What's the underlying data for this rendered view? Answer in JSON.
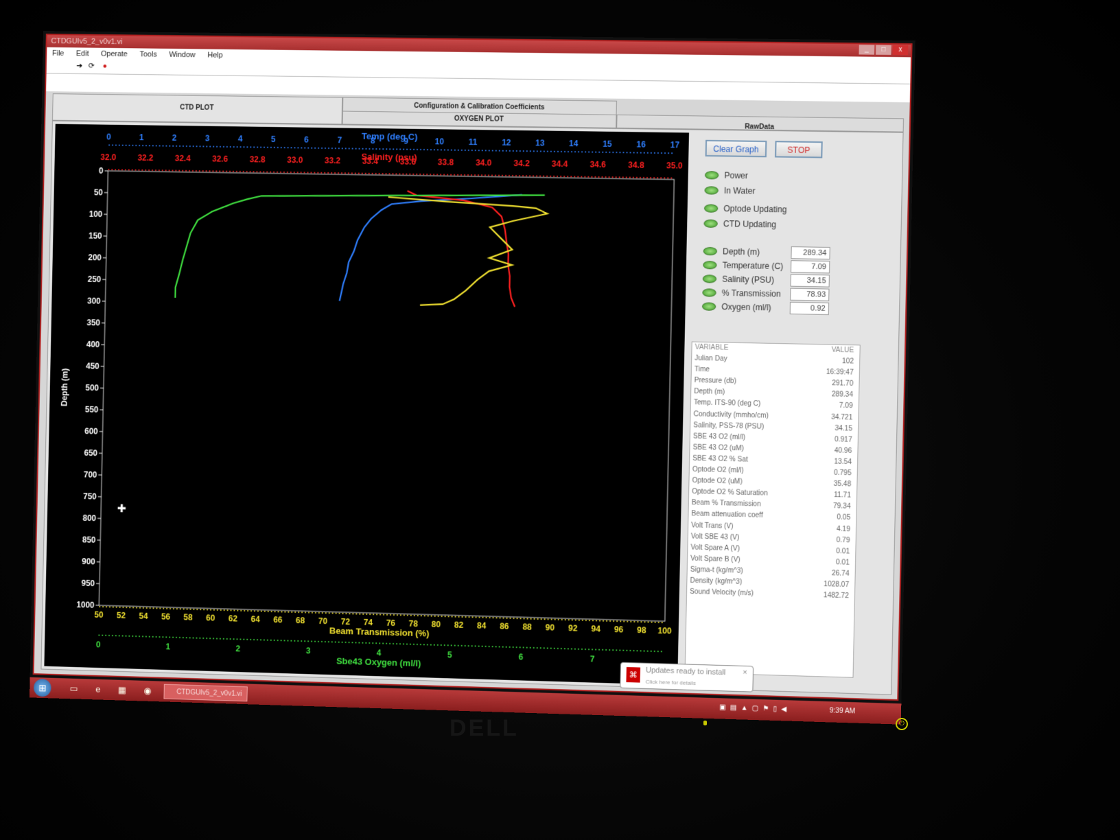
{
  "window": {
    "title": "CTDGUIv5_2_v0v1.vi",
    "controls": [
      "_",
      "□",
      "x"
    ]
  },
  "menu": [
    "File",
    "Edit",
    "Operate",
    "Tools",
    "Window",
    "Help"
  ],
  "toolbar_icons": [
    "run-arrow-icon",
    "run-continuous-icon",
    "abort-icon"
  ],
  "tabs": {
    "ctd": "CTD PLOT",
    "config": "Configuration & Calibration Coefficients",
    "oxygen": "OXYGEN PLOT",
    "raw": "RawData"
  },
  "buttons": {
    "clear": "Clear Graph",
    "stop": "STOP"
  },
  "indicators": [
    "Power",
    "In Water",
    "Optode Updating",
    "CTD Updating"
  ],
  "readouts": [
    {
      "label": "Depth (m)",
      "value": "289.34"
    },
    {
      "label": "Temperature (C)",
      "value": "7.09"
    },
    {
      "label": "Salinity (PSU)",
      "value": "34.15"
    },
    {
      "label": "% Transmission",
      "value": "78.93"
    },
    {
      "label": "Oxygen (ml/l)",
      "value": "0.92"
    }
  ],
  "variables": {
    "header": [
      "VARIABLE",
      "VALUE"
    ],
    "rows": [
      [
        "Julian Day",
        "102"
      ],
      [
        "Time",
        "16:39:47"
      ],
      [
        "Pressure (db)",
        "291.70"
      ],
      [
        "Depth (m)",
        "289.34"
      ],
      [
        "Temp. ITS-90 (deg C)",
        "7.09"
      ],
      [
        "Conductivity (mmho/cm)",
        "34.721"
      ],
      [
        "Salinity, PSS-78 (PSU)",
        "34.15"
      ],
      [
        "SBE 43 O2 (ml/l)",
        "0.917"
      ],
      [
        "SBE 43 O2 (uM)",
        "40.96"
      ],
      [
        "SBE 43 O2 % Sat",
        "13.54"
      ],
      [
        "Optode O2 (ml/l)",
        "0.795"
      ],
      [
        "Optode O2 (uM)",
        "35.48"
      ],
      [
        "Optode O2 % Saturation",
        "11.71"
      ],
      [
        "Beam % Transmission",
        "79.34"
      ],
      [
        "Beam attenuation coeff",
        "0.05"
      ],
      [
        "Volt Trans (V)",
        "4.19"
      ],
      [
        "Volt SBE 43 (V)",
        "0.79"
      ],
      [
        "Volt Spare A (V)",
        "0.01"
      ],
      [
        "Volt Spare B (V)",
        "0.01"
      ],
      [
        "Sigma-t (kg/m^3)",
        "26.74"
      ],
      [
        "Density (kg/m^3)",
        "1028.07"
      ],
      [
        "Sound Velocity (m/s)",
        "1482.72"
      ]
    ]
  },
  "chart_data": {
    "type": "line",
    "ylabel": "Depth (m)",
    "ylim": [
      1000,
      0
    ],
    "yticks": [
      0,
      50,
      100,
      150,
      200,
      250,
      300,
      350,
      400,
      450,
      500,
      550,
      600,
      650,
      700,
      750,
      800,
      850,
      900,
      950,
      1000
    ],
    "axes": {
      "temp": {
        "label": "Temp (deg C)",
        "range": [
          0,
          17
        ],
        "ticks": [
          0,
          1,
          2,
          3,
          4,
          5,
          6,
          7,
          8,
          9,
          10,
          11,
          12,
          13,
          14,
          15,
          16,
          17
        ],
        "color": "#2f7fff"
      },
      "salinity": {
        "label": "Salinity (psu)",
        "range": [
          32.0,
          35.0
        ],
        "ticks": [
          "32.0",
          "32.2",
          "32.4",
          "32.6",
          "32.8",
          "33.0",
          "33.2",
          "33.4",
          "33.6",
          "33.8",
          "34.0",
          "34.2",
          "34.4",
          "34.6",
          "34.8",
          "35.0"
        ],
        "color": "#ff2020"
      },
      "transmission": {
        "label": "Beam Transmission (%)",
        "range": [
          50,
          100
        ],
        "ticks": [
          50,
          52,
          54,
          56,
          58,
          60,
          62,
          64,
          66,
          68,
          70,
          72,
          74,
          76,
          78,
          80,
          82,
          84,
          86,
          88,
          90,
          92,
          94,
          96,
          98,
          100
        ],
        "color": "#f0e030"
      },
      "oxygen": {
        "label": "Sbe43 Oxygen (ml/l)",
        "range": [
          0,
          8
        ],
        "ticks": [
          0,
          1,
          2,
          3,
          4,
          5,
          6,
          7
        ],
        "color": "#40e040"
      }
    },
    "series": [
      {
        "axis": "temp",
        "color": "#2f7fff",
        "points": [
          [
            12.5,
            40
          ],
          [
            11,
            50
          ],
          [
            9.5,
            58
          ],
          [
            8.6,
            66
          ],
          [
            8.3,
            80
          ],
          [
            8.0,
            100
          ],
          [
            7.8,
            120
          ],
          [
            7.6,
            150
          ],
          [
            7.5,
            175
          ],
          [
            7.35,
            200
          ],
          [
            7.3,
            225
          ],
          [
            7.2,
            250
          ],
          [
            7.15,
            270
          ],
          [
            7.1,
            289
          ]
        ]
      },
      {
        "axis": "salinity",
        "points": [
          [
            33.6,
            35
          ],
          [
            33.65,
            45
          ],
          [
            33.9,
            55
          ],
          [
            34.05,
            70
          ],
          [
            34.1,
            90
          ],
          [
            34.12,
            120
          ],
          [
            34.13,
            150
          ],
          [
            34.14,
            175
          ],
          [
            34.14,
            200
          ],
          [
            34.15,
            225
          ],
          [
            34.15,
            250
          ],
          [
            34.16,
            275
          ],
          [
            34.18,
            295
          ]
        ],
        "color": "#ff2020"
      },
      {
        "axis": "transmission",
        "points": [
          [
            75,
            50
          ],
          [
            80,
            58
          ],
          [
            86,
            66
          ],
          [
            88,
            70
          ],
          [
            89,
            82
          ],
          [
            86,
            100
          ],
          [
            84,
            115
          ],
          [
            85,
            140
          ],
          [
            86,
            165
          ],
          [
            84,
            185
          ],
          [
            86,
            200
          ],
          [
            84,
            215
          ],
          [
            83,
            235
          ],
          [
            82,
            260
          ],
          [
            81,
            280
          ],
          [
            80,
            292
          ],
          [
            78,
            295
          ]
        ],
        "color": "#f0e030"
      },
      {
        "axis": "oxygen",
        "points": [
          [
            6.2,
            40
          ],
          [
            4.5,
            45
          ],
          [
            2.2,
            52
          ],
          [
            2.0,
            60
          ],
          [
            1.8,
            70
          ],
          [
            1.5,
            90
          ],
          [
            1.3,
            110
          ],
          [
            1.2,
            140
          ],
          [
            1.15,
            170
          ],
          [
            1.1,
            200
          ],
          [
            1.05,
            235
          ],
          [
            1.0,
            265
          ],
          [
            1.0,
            289
          ]
        ],
        "color": "#40e040"
      }
    ]
  },
  "taskbar": {
    "task_button": "CTDGUIv5_2_v0v1.vi",
    "clock": "9:39 AM",
    "balloon_title": "Updates ready to install",
    "balloon_sub": "Click here for details"
  },
  "monitor_brand": "DELL"
}
